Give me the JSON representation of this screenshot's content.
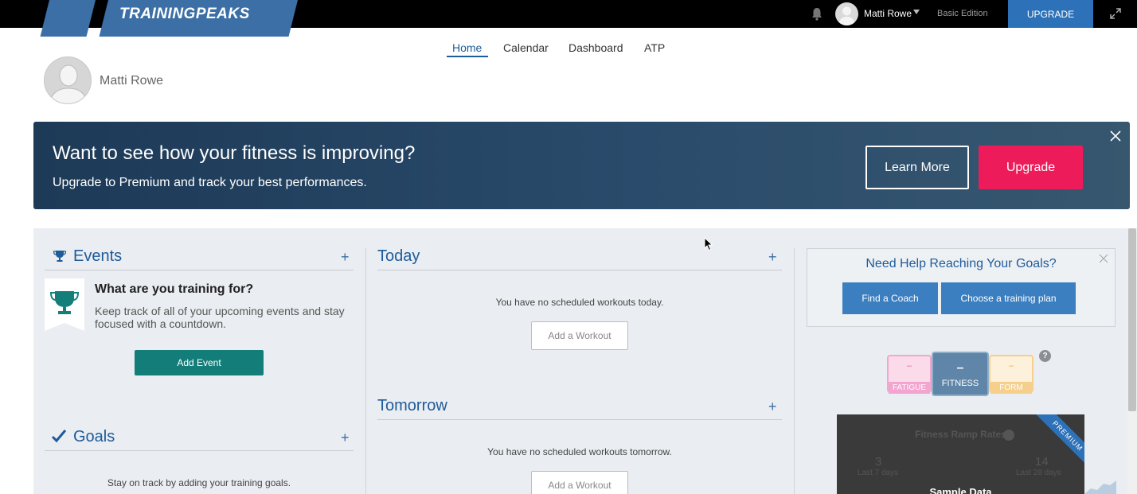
{
  "topbar": {
    "logo": "TRAININGPEAKS",
    "username": "Matti Rowe",
    "edition": "Basic Edition",
    "upgrade_label": "UPGRADE"
  },
  "nav": {
    "items": [
      "Home",
      "Calendar",
      "Dashboard",
      "ATP"
    ],
    "active": "Home"
  },
  "profile": {
    "name": "Matti Rowe"
  },
  "banner": {
    "title": "Want to see how your fitness is improving?",
    "subtitle": "Upgrade to Premium and track your best performances.",
    "learn_more": "Learn More",
    "upgrade": "Upgrade"
  },
  "events": {
    "title": "Events",
    "heading": "What are you training for?",
    "description": "Keep track of all of your upcoming events and stay focused with a countdown.",
    "add_label": "Add Event"
  },
  "goals": {
    "title": "Goals",
    "description": "Stay on track by adding your training goals."
  },
  "today": {
    "title": "Today",
    "empty": "You have no scheduled workouts today.",
    "add_label": "Add a Workout"
  },
  "tomorrow": {
    "title": "Tomorrow",
    "empty": "You have no scheduled workouts tomorrow.",
    "add_label": "Add a Workout"
  },
  "help": {
    "title": "Need Help Reaching Your Goals?",
    "find_coach": "Find a Coach",
    "choose_plan": "Choose a training plan"
  },
  "metrics": {
    "fatigue": {
      "value": "–",
      "label": "FATIGUE"
    },
    "fitness": {
      "value": "–",
      "label": "FITNESS"
    },
    "form": {
      "value": "–",
      "label": "FORM"
    },
    "help_mark": "?"
  },
  "ramp": {
    "title": "Fitness Ramp Rates",
    "left_value": "3",
    "left_label": "Last 7 days",
    "right_value": "14",
    "right_label": "Last 28 days",
    "sample": "Sample Data",
    "ribbon": "PREMIUM"
  },
  "colors": {
    "brand_blue": "#2d72b8",
    "upgrade_pink": "#ee1b5a",
    "event_teal": "#137d79"
  }
}
